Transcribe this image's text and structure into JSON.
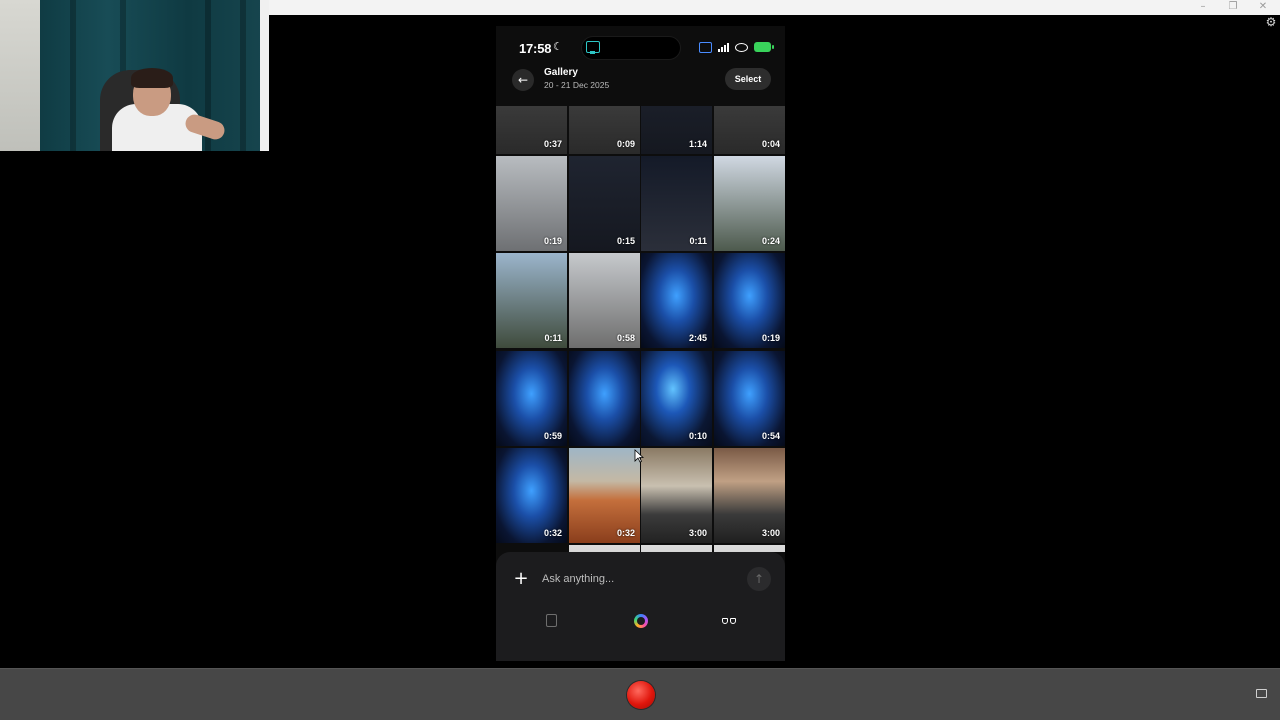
{
  "status_bar": {
    "time": "17:58",
    "icons": [
      "moon-icon",
      "screen-cast-icon",
      "screen-mirror-icon",
      "signal-icon",
      "eye-icon",
      "battery-icon"
    ]
  },
  "header": {
    "title": "Gallery",
    "dates": "20 - 21 Dec 2025",
    "select_label": "Select"
  },
  "gallery": {
    "rows": [
      [
        "0:37",
        "0:09",
        "1:14",
        "0:04"
      ],
      [
        "0:19",
        "0:15",
        "0:11",
        "0:24"
      ],
      [
        "0:11",
        "0:58",
        "2:45",
        "0:19"
      ],
      [
        "0:59",
        "",
        "0:10",
        "0:54"
      ],
      [
        "0:32",
        "0:32",
        "3:00",
        "3:00"
      ]
    ]
  },
  "composer": {
    "placeholder": "Ask anything..."
  },
  "colors": {
    "record": "#e0160c",
    "ai_ring": "#a855f7",
    "battery": "#39d35b"
  }
}
